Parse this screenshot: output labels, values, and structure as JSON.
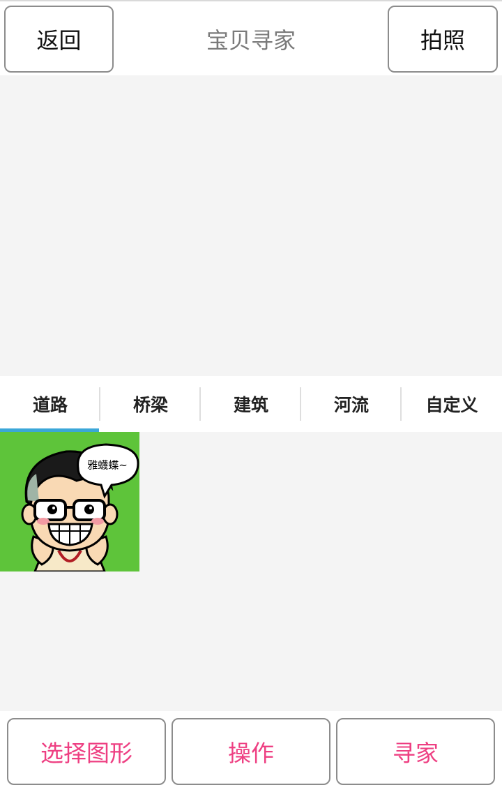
{
  "header": {
    "back_label": "返回",
    "title": "宝贝寻家",
    "photo_label": "拍照"
  },
  "tabs": [
    {
      "label": "道路",
      "active": true
    },
    {
      "label": "桥梁"
    },
    {
      "label": "建筑"
    },
    {
      "label": "河流"
    },
    {
      "label": "自定义"
    }
  ],
  "thumbnail": {
    "speech_text": "雅蠛蝶~"
  },
  "footer": {
    "select_shape_label": "选择图形",
    "operate_label": "操作",
    "find_home_label": "寻家"
  },
  "colors": {
    "accent_pink": "#ee3f82",
    "tab_indicator": "#3ba7d8",
    "thumb_bg": "#5ec43a"
  }
}
